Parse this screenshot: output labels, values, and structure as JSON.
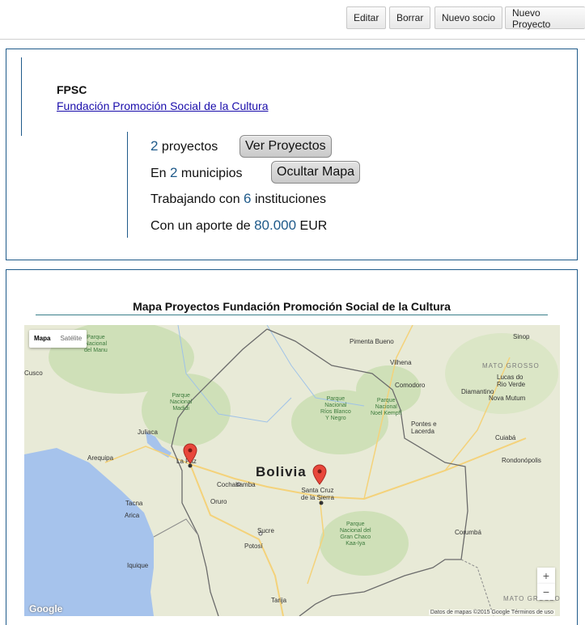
{
  "toolbar": {
    "editar": "Editar",
    "borrar": "Borrar",
    "nuevo_socio": "Nuevo socio",
    "nuevo_proyecto": "Nuevo Proyecto"
  },
  "org": {
    "abbr": "FPSC",
    "name": "Fundación Promoción Social de la Cultura"
  },
  "stats": {
    "projects_count": "2",
    "projects_text": " proyectos",
    "ver_proyectos": "Ver Proyectos",
    "municipios_prefix": "En ",
    "municipios_count": "2",
    "municipios_text": " municipios",
    "ocultar_mapa": "Ocultar Mapa",
    "instituciones_prefix": "Trabajando con ",
    "instituciones_count": "6",
    "instituciones_text": " instituciones",
    "aporte_prefix": "Con un aporte de ",
    "aporte_amount": "80.000",
    "aporte_currency": " EUR"
  },
  "map": {
    "title": "Mapa Proyectos Fundación Promoción Social de la Cultura",
    "type_map": "Mapa",
    "type_sat": "Satélite",
    "zoom_in": "+",
    "zoom_out": "−",
    "google": "Google",
    "credits": "Datos de mapas ©2015 Google    Términos de uso",
    "country": "Bolivia",
    "labels": {
      "la_paz": "La Paz",
      "santa_cruz": "Santa Cruz\nde la Sierra",
      "cochabamba": "Cochabamba",
      "oruro": "Oruro",
      "sucre": "Sucre",
      "potosi": "Potosí",
      "tarija": "Tarija",
      "arequipa": "Arequipa",
      "juliaca": "Juliaca",
      "tacna": "Tacna",
      "arica": "Arica",
      "iquique": "Iquique",
      "cuiaba": "Cuiabá",
      "rondonopolis": "Rondonópolis",
      "pontes": "Pontes e\nLacerda",
      "vilhena": "Vilhena",
      "comodoro": "Comodoro",
      "pimenta": "Pimenta Bueno",
      "sinop": "Sinop",
      "lucas": "Lucas do\nRio Verde",
      "diamantino": "Diamantino",
      "nova_mutum": "Nova Mutum",
      "corumba": "Corumbá",
      "cusco": "Cusco",
      "mato_grosso_1": "MATO GROSSO",
      "mato_grosso_2": "MATO GROSSO",
      "pn_manu": "Parque\nNacional\ndel Manu",
      "pn_madidi": "Parque\nNacional\nMadidi",
      "pn_rios": "Parque\nNacional\nRíos Blanco\nY Negro",
      "pn_noel": "Parque\nNacional\nNoel Kempff",
      "pn_chaco": "Parque\nNacional del\nGran Chaco\nKaa-Iya"
    }
  }
}
